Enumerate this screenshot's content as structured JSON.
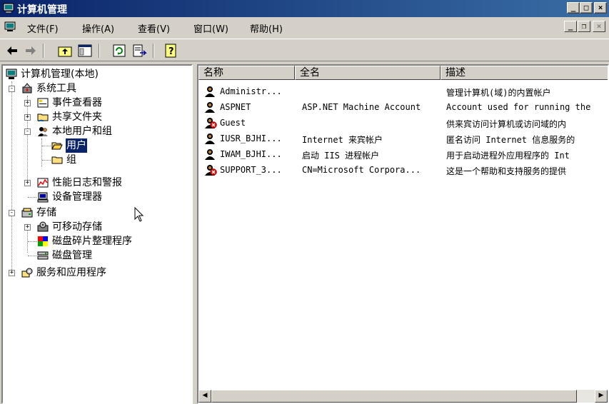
{
  "window": {
    "title": "计算机管理"
  },
  "menu": [
    {
      "label": "文件(F)"
    },
    {
      "label": "操作(A)"
    },
    {
      "label": "查看(V)"
    },
    {
      "label": "窗口(W)"
    },
    {
      "label": "帮助(H)"
    }
  ],
  "tree": {
    "root": "计算机管理(本地)",
    "system_tools": "系统工具",
    "event_viewer": "事件查看器",
    "shared_folders": "共享文件夹",
    "local_users_groups": "本地用户和组",
    "users": "用户",
    "groups": "组",
    "perf_logs": "性能日志和警报",
    "device_manager": "设备管理器",
    "storage": "存储",
    "removable_storage": "可移动存储",
    "disk_defrag": "磁盘碎片整理程序",
    "disk_mgmt": "磁盘管理",
    "services_apps": "服务和应用程序"
  },
  "list": {
    "columns": {
      "name": "名称",
      "full_name": "全名",
      "description": "描述"
    },
    "rows": [
      {
        "name": "Administr...",
        "full_name": "",
        "description": "管理计算机(域)的内置帐户",
        "disabled": false
      },
      {
        "name": "ASPNET",
        "full_name": "ASP.NET Machine Account",
        "description": "Account used for running the",
        "disabled": false
      },
      {
        "name": "Guest",
        "full_name": "",
        "description": "供来宾访问计算机或访问域的内",
        "disabled": true
      },
      {
        "name": "IUSR_BJHI...",
        "full_name": "Internet 来宾帐户",
        "description": "匿名访问 Internet 信息服务的",
        "disabled": false
      },
      {
        "name": "IWAM_BJHI...",
        "full_name": "启动 IIS 进程帐户",
        "description": "用于启动进程外应用程序的 Int",
        "disabled": false
      },
      {
        "name": "SUPPORT_3...",
        "full_name": "CN=Microsoft Corpora...",
        "description": "这是一个帮助和支持服务的提供",
        "disabled": true
      }
    ]
  },
  "colors": {
    "titlebar": "#0a246a",
    "selection": "#0a246a",
    "face": "#d4d0c8"
  }
}
